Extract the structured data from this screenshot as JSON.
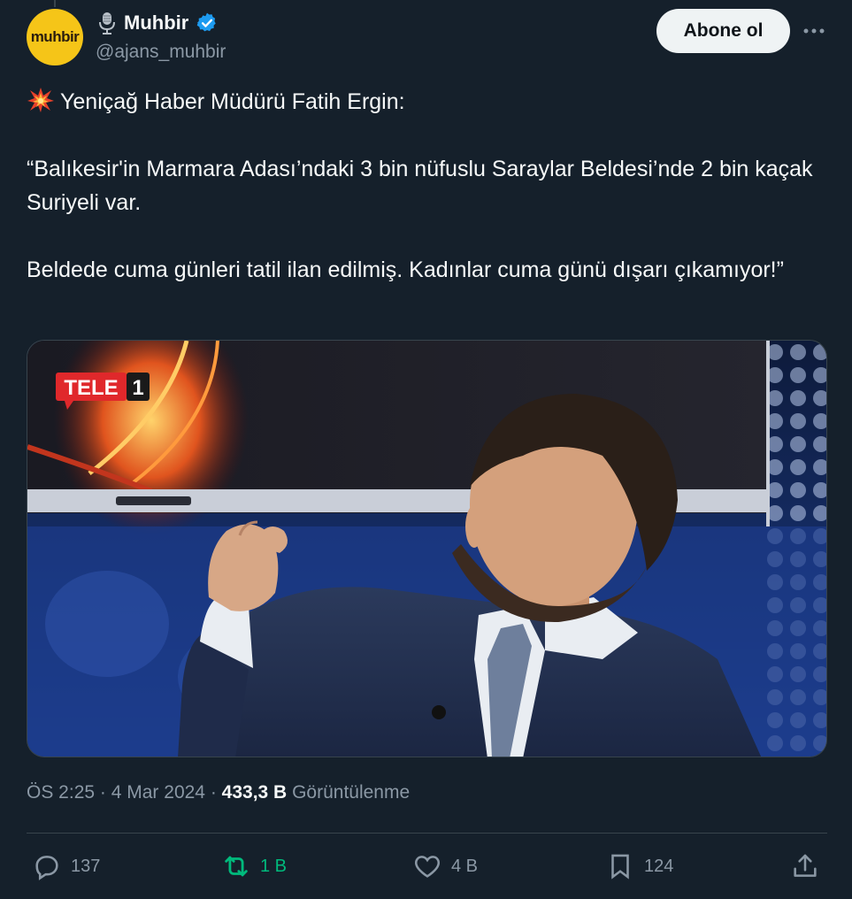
{
  "author": {
    "avatar_text": "muhbir",
    "display_name": "Muhbir",
    "handle": "@ajans_muhbir",
    "verified": true
  },
  "follow_button": "Abone ol",
  "more_icon": "more-horizontal-icon",
  "tweet": {
    "lines": [
      "Yeniçağ Haber Müdürü Fatih Ergin:",
      "“Balıkesir'in Marmara Adası’ndaki 3 bin nüfuslu Saraylar Beldesi’nde 2 bin kaçak Suriyeli var.",
      "Beldede cuma günleri tatil ilan edilmiş. Kadınlar cuma günü dışarı çıkamıyor!”"
    ],
    "emoji_icon": "collision-burst-icon"
  },
  "media": {
    "channel_logo": "TELE",
    "channel_number": "1"
  },
  "meta": {
    "time": "ÖS 2:25",
    "separator": "·",
    "date": "4 Mar 2024",
    "views_count": "433,3 B",
    "views_label": "Görüntülenme"
  },
  "actions": {
    "reply": "137",
    "retweet": "1 B",
    "like": "4 B",
    "bookmark": "124"
  },
  "colors": {
    "background": "#15202b",
    "text": "#f7f9f9",
    "muted": "#8b98a5",
    "retweet_green": "#00ba7c",
    "verified_blue": "#1d9bf0",
    "avatar_yellow": "#f5c518"
  }
}
